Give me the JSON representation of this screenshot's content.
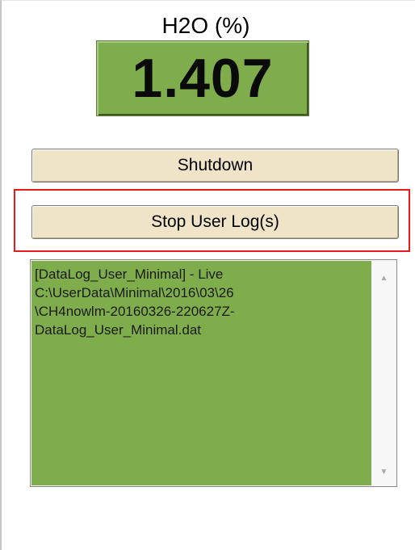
{
  "reading": {
    "label": "H2O (%)",
    "value": "1.407"
  },
  "buttons": {
    "shutdown_label": "Shutdown",
    "stop_user_log_label": "Stop User Log(s)"
  },
  "log_panel": {
    "text": "[DataLog_User_Minimal] - Live\nC:\\UserData\\Minimal\\2016\\03\\26\n\\CH4nowlm-20160326-220627Z-\nDataLog_User_Minimal.dat",
    "scroll_up_icon": "▲",
    "scroll_down_icon": "▼"
  },
  "colors": {
    "reading_bg": "#7fad4b",
    "button_bg": "#efe4c7",
    "highlight_border": "#e81b1b"
  }
}
